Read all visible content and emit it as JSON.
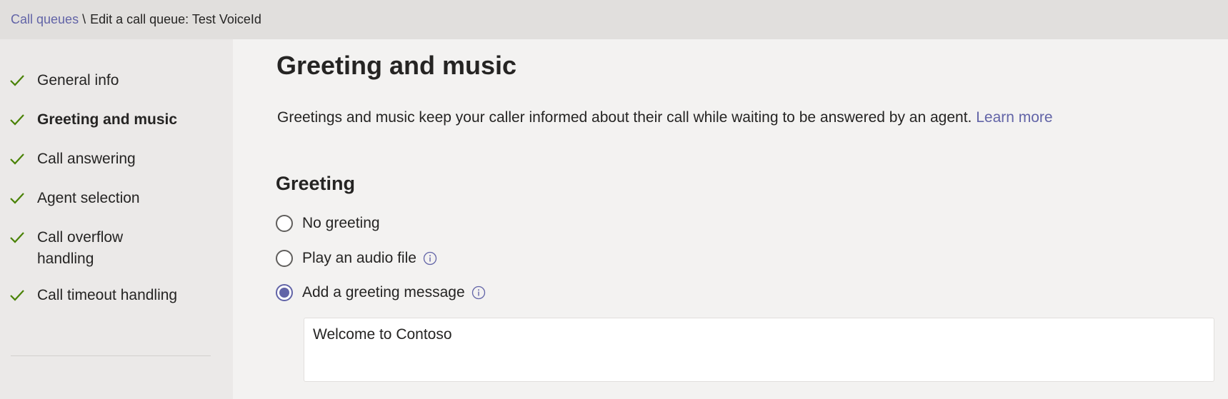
{
  "breadcrumb": {
    "parent": "Call queues",
    "separator": "\\",
    "current": "Edit a call queue: Test VoiceId"
  },
  "sidebar": {
    "items": [
      {
        "label": "General info",
        "completed": true,
        "active": false
      },
      {
        "label": "Greeting and music",
        "completed": true,
        "active": true
      },
      {
        "label": "Call answering",
        "completed": true,
        "active": false
      },
      {
        "label": "Agent selection",
        "completed": true,
        "active": false
      },
      {
        "label": "Call overflow handling",
        "completed": true,
        "active": false
      },
      {
        "label": "Call timeout handling",
        "completed": true,
        "active": false
      }
    ]
  },
  "main": {
    "title": "Greeting and music",
    "description": "Greetings and music keep your caller informed about their call while waiting to be answered by an agent.",
    "learn_more": "Learn more",
    "greeting": {
      "section_title": "Greeting",
      "options": [
        {
          "label": "No greeting",
          "selected": false,
          "info_icon": false
        },
        {
          "label": "Play an audio file",
          "selected": false,
          "info_icon": true
        },
        {
          "label": "Add a greeting message",
          "selected": true,
          "info_icon": true
        }
      ],
      "message_value": "Welcome to Contoso"
    }
  },
  "colors": {
    "accent": "#6264a7",
    "check": "#498205",
    "topbar_bg": "#e1dfdd",
    "sidebar_bg": "#ebe9e8",
    "page_bg": "#f3f2f1"
  },
  "icons": {
    "check": "checkmark-icon",
    "info": "info-icon"
  }
}
